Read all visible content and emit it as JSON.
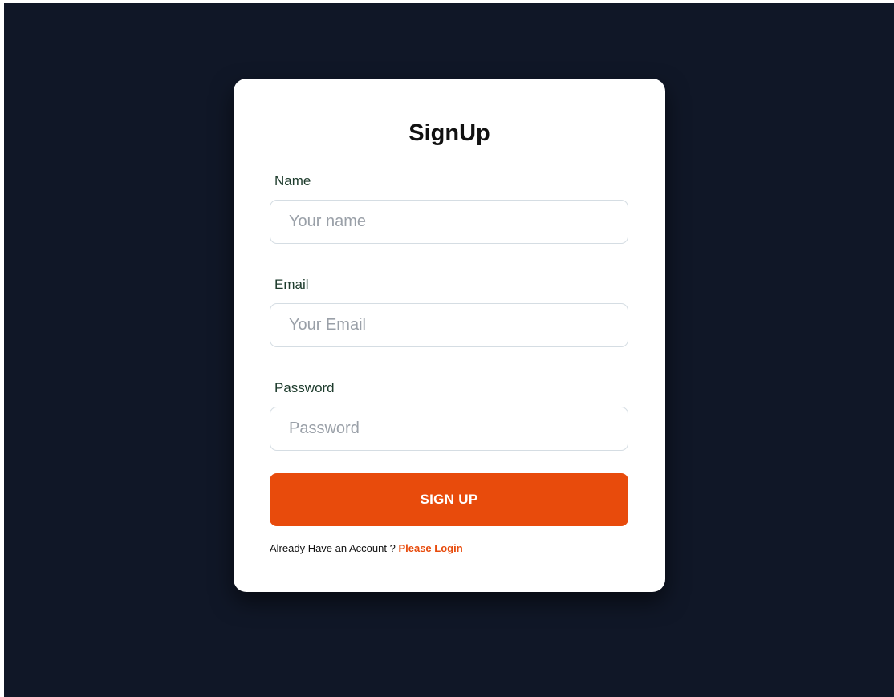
{
  "form": {
    "title": "SignUp",
    "name_label": "Name",
    "name_placeholder": "Your name",
    "email_label": "Email",
    "email_placeholder": "Your Email",
    "password_label": "Password",
    "password_placeholder": "Password",
    "submit_label": "SIGN UP",
    "footer_text": "Already Have an Account ?",
    "login_link": "Please Login"
  },
  "colors": {
    "background": "#101727",
    "card": "#ffffff",
    "accent": "#e84b0c",
    "label": "#1d3b2c"
  }
}
